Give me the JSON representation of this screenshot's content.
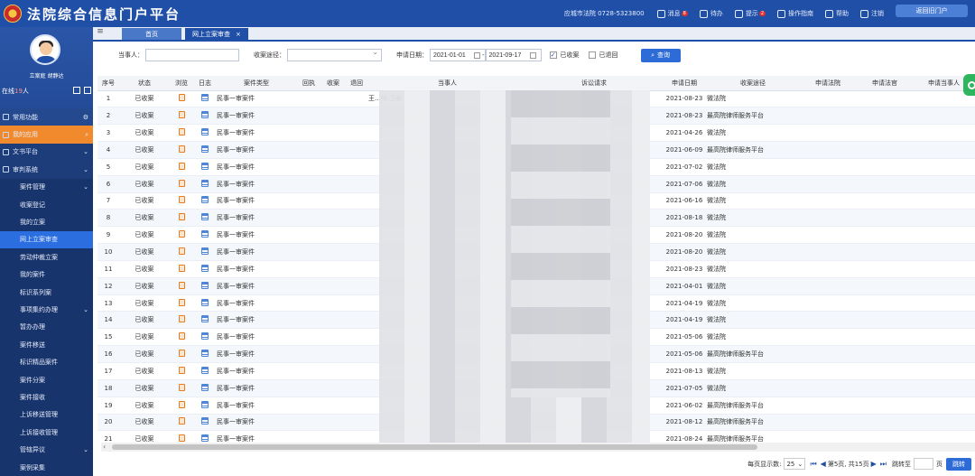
{
  "app": {
    "title": "法院综合信息门户平台"
  },
  "header": {
    "court": "应城市法院 0728-5323800",
    "items": [
      {
        "label": "消息",
        "badge": "8"
      },
      {
        "label": "待办"
      },
      {
        "label": "提示",
        "badge": "2"
      },
      {
        "label": "操作指南"
      },
      {
        "label": "帮助"
      },
      {
        "label": "注销"
      }
    ],
    "user_button": "返回旧门户"
  },
  "sidebar": {
    "profile_name": "立案庭 胡静达",
    "online_prefix": "在线",
    "online_count": "19",
    "online_suffix": "人",
    "items": [
      {
        "label": "常用功能",
        "type": "common"
      },
      {
        "label": "我的应用",
        "type": "orange"
      },
      {
        "label": "文书平台",
        "type": "top"
      },
      {
        "label": "审判系统",
        "type": "top"
      },
      {
        "label": "案件管理",
        "type": "sub"
      },
      {
        "label": "收案登记",
        "type": "sub"
      },
      {
        "label": "我的立案",
        "type": "sub"
      },
      {
        "label": "网上立案审查",
        "type": "active"
      },
      {
        "label": "劳动仲裁立案",
        "type": "sub"
      },
      {
        "label": "我的案件",
        "type": "sub"
      },
      {
        "label": "标识系列案",
        "type": "sub"
      },
      {
        "label": "事项集约办理",
        "type": "sub"
      },
      {
        "label": "暂办办理",
        "type": "sub"
      },
      {
        "label": "案件移送",
        "type": "sub"
      },
      {
        "label": "标识精品案件",
        "type": "sub"
      },
      {
        "label": "案件分案",
        "type": "sub"
      },
      {
        "label": "案件接收",
        "type": "sub"
      },
      {
        "label": "上诉移送管理",
        "type": "sub"
      },
      {
        "label": "上诉接收管理",
        "type": "sub"
      },
      {
        "label": "管辖异议",
        "type": "sub"
      },
      {
        "label": "案例采集",
        "type": "sub"
      }
    ]
  },
  "tabs": [
    {
      "label": "首页"
    },
    {
      "label": "网上立案审查",
      "close": "×"
    }
  ],
  "search": {
    "party_label": "当事人：",
    "party_value": "",
    "channel_label": "收案途径：",
    "channel_value": "",
    "date_label": "申请日期：",
    "date_from": "2021-01-01",
    "date_sep": "-",
    "date_to": "2021-09-17",
    "received_label": "已收案",
    "returned_label": "已退回",
    "query_button": "查询"
  },
  "table": {
    "columns": [
      "序号",
      "状态",
      "浏览",
      "日志",
      "案件类型",
      "回执",
      "收案",
      "退回",
      "当事人",
      "诉讼请求",
      "申请日期",
      "收案途径",
      "申请法院",
      "申请法官",
      "申请当事人"
    ],
    "rows": [
      {
        "no": "1",
        "status": "已收案",
        "type": "民事一审案件",
        "party": "王…林,卫泰",
        "claim": "…仑87",
        "date": "2021-08-23",
        "channel": "微法院"
      },
      {
        "no": "2",
        "status": "已收案",
        "type": "民事一审案件",
        "party": "",
        "claim": "",
        "date": "2021-08-23",
        "channel": "最高院律师服务平台"
      },
      {
        "no": "3",
        "status": "已收案",
        "type": "民事一审案件",
        "party": "",
        "claim": "…ф",
        "date": "2021-04-26",
        "channel": "微法院"
      },
      {
        "no": "4",
        "status": "已收案",
        "type": "民事一审案件",
        "party": "",
        "claim": "",
        "date": "2021-06-09",
        "channel": "最高院律师服务平台"
      },
      {
        "no": "5",
        "status": "已收案",
        "type": "民事一审案件",
        "party": "",
        "claim": "",
        "date": "2021-07-02",
        "channel": "微法院"
      },
      {
        "no": "6",
        "status": "已收案",
        "type": "民事一审案件",
        "party": "",
        "claim": "",
        "date": "2021-07-06",
        "channel": "微法院"
      },
      {
        "no": "7",
        "status": "已收案",
        "type": "民事一审案件",
        "party": "",
        "claim": "",
        "date": "2021-06-16",
        "channel": "微法院"
      },
      {
        "no": "8",
        "status": "已收案",
        "type": "民事一审案件",
        "party": "",
        "claim": "",
        "date": "2021-08-18",
        "channel": "微法院"
      },
      {
        "no": "9",
        "status": "已收案",
        "type": "民事一审案件",
        "party": "",
        "claim": "",
        "date": "2021-08-20",
        "channel": "微法院"
      },
      {
        "no": "10",
        "status": "已收案",
        "type": "民事一审案件",
        "party": "",
        "claim": "",
        "date": "2021-08-20",
        "channel": "微法院"
      },
      {
        "no": "11",
        "status": "已收案",
        "type": "民事一审案件",
        "party": "",
        "claim": "",
        "date": "2021-08-23",
        "channel": "微法院"
      },
      {
        "no": "12",
        "status": "已收案",
        "type": "民事一审案件",
        "party": "",
        "claim": "",
        "date": "2021-04-01",
        "channel": "微法院"
      },
      {
        "no": "13",
        "status": "已收案",
        "type": "民事一审案件",
        "party": "",
        "claim": "",
        "date": "2021-04-19",
        "channel": "微法院"
      },
      {
        "no": "14",
        "status": "已收案",
        "type": "民事一审案件",
        "party": "",
        "claim": "",
        "date": "2021-04-19",
        "channel": "微法院"
      },
      {
        "no": "15",
        "status": "已收案",
        "type": "民事一审案件",
        "party": "",
        "claim": "",
        "date": "2021-05-06",
        "channel": "微法院"
      },
      {
        "no": "16",
        "status": "已收案",
        "type": "民事一审案件",
        "party": "",
        "claim": "",
        "date": "2021-05-06",
        "channel": "最高院律师服务平台"
      },
      {
        "no": "17",
        "status": "已收案",
        "type": "民事一审案件",
        "party": "",
        "claim": "",
        "date": "2021-08-13",
        "channel": "微法院"
      },
      {
        "no": "18",
        "status": "已收案",
        "type": "民事一审案件",
        "party": "",
        "claim": "",
        "date": "2021-07-05",
        "channel": "微法院"
      },
      {
        "no": "19",
        "status": "已收案",
        "type": "民事一审案件",
        "party": "",
        "claim": "",
        "date": "2021-06-02",
        "channel": "最高院律师服务平台"
      },
      {
        "no": "20",
        "status": "已收案",
        "type": "民事一审案件",
        "party": "",
        "claim": "",
        "date": "2021-08-12",
        "channel": "最高院律师服务平台"
      },
      {
        "no": "21",
        "status": "已收案",
        "type": "民事一审案件",
        "party": "",
        "claim": "",
        "date": "2021-08-24",
        "channel": "最高院律师服务平台"
      }
    ]
  },
  "pager": {
    "page_size_label": "每页显示数:",
    "page_size": "25",
    "page_info": "第5页, 共15页",
    "goto_label": "跳转至",
    "page_unit": "页",
    "goto_button": "跳转"
  },
  "colors": {
    "primary": "#1f4fa6",
    "sidebar": "#1d3c7a",
    "accent_orange": "#f08a2c",
    "button": "#2d6bd6"
  }
}
